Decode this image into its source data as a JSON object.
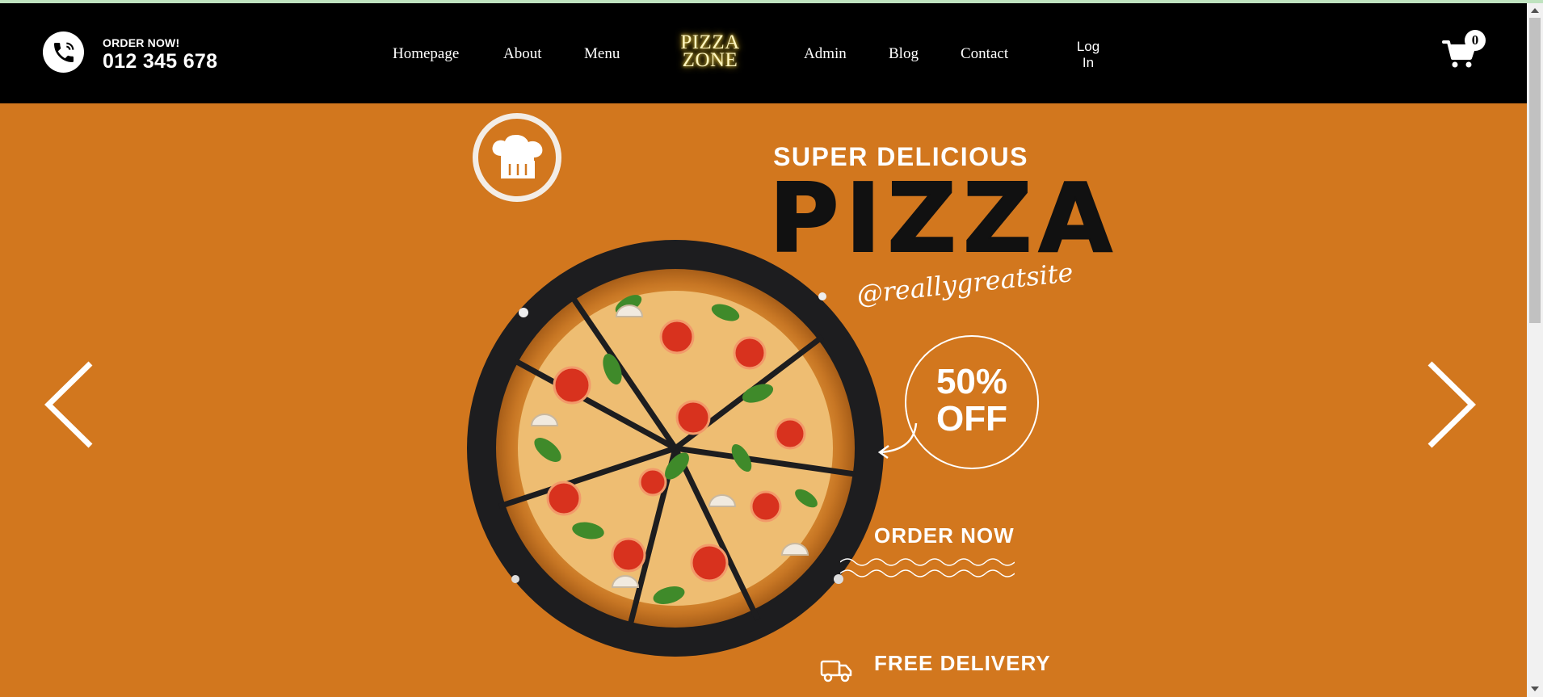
{
  "header": {
    "order_label": "ORDER NOW!",
    "phone": "012 345 678",
    "nav": {
      "homepage": "Homepage",
      "about": "About",
      "menu": "Menu",
      "admin": "Admin",
      "blog": "Blog",
      "contact": "Contact"
    },
    "logo_line1": "PIZZA",
    "logo_line2": "ZONE",
    "login_line1": "Log",
    "login_line2": "In",
    "cart_count": "0"
  },
  "hero": {
    "subtitle": "SUPER DELICIOUS",
    "title": "PIZZA",
    "handle": "@reallygreatsite",
    "discount_line1": "50%",
    "discount_line2": "OFF",
    "cta": "ORDER NOW",
    "delivery": "FREE DELIVERY"
  },
  "icons": {
    "phone": "phone-icon",
    "cart": "cart-icon",
    "chef_hat": "chef-hat-icon",
    "truck": "truck-icon",
    "prev": "chevron-left-icon",
    "next": "chevron-right-icon"
  },
  "colors": {
    "header_bg": "#000000",
    "hero_bg": "#d2771e",
    "logo_glow": "#f5d94a",
    "text": "#ffffff"
  }
}
